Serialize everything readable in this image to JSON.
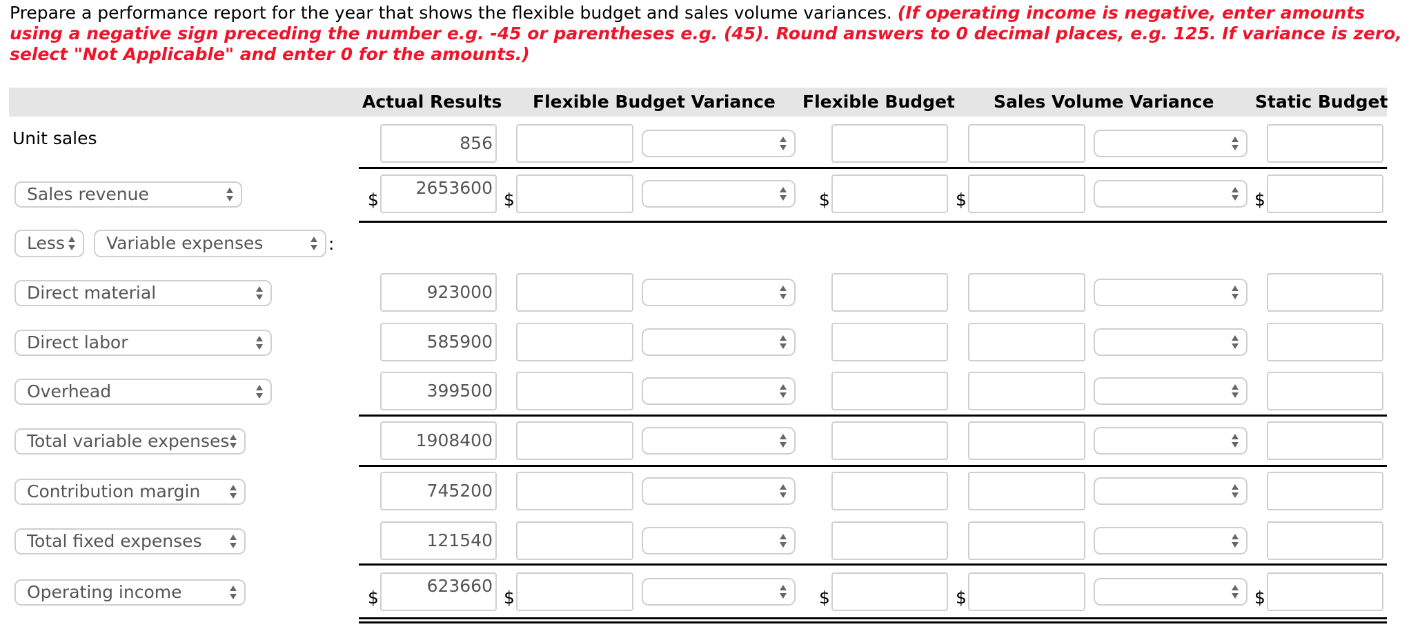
{
  "instructions": {
    "plain": "Prepare a performance report for the year that shows the flexible budget and sales volume variances. ",
    "emphasis": "(If operating income is negative, enter amounts using a negative sign preceding the number e.g. -45 or parentheses e.g. (45). Round answers to 0 decimal places, e.g. 125. If variance is zero, select \"Not Applicable\" and enter 0 for the amounts.)"
  },
  "columns": [
    "Actual Results",
    "Flexible Budget Variance",
    "Flexible Budget",
    "Sales Volume Variance",
    "Static Budget"
  ],
  "rows": [
    {
      "label": "Unit sales",
      "label_is_select": false,
      "actual": "856",
      "dollar": false
    },
    {
      "label": "Sales revenue",
      "label_is_select": true,
      "actual": "2653600",
      "dollar": true
    },
    {
      "label_prefix": "Less",
      "label": "Variable expenses",
      "label_is_select": true,
      "heading": true,
      "suffix": ":"
    },
    {
      "label": "Direct material",
      "label_is_select": true,
      "actual": "923000",
      "dollar": false
    },
    {
      "label": "Direct labor",
      "label_is_select": true,
      "actual": "585900",
      "dollar": false
    },
    {
      "label": "Overhead",
      "label_is_select": true,
      "actual": "399500",
      "dollar": false
    },
    {
      "label": "Total variable expenses",
      "label_is_select": true,
      "actual": "1908400",
      "dollar": false
    },
    {
      "label": "Contribution margin",
      "label_is_select": true,
      "actual": "745200",
      "dollar": false
    },
    {
      "label": "Total fixed expenses",
      "label_is_select": true,
      "actual": "121540",
      "dollar": false
    },
    {
      "label": "Operating income",
      "label_is_select": true,
      "actual": "623660",
      "dollar": true
    }
  ],
  "currency_symbol": "$",
  "colors": {
    "instruction_red": "#f0142a",
    "header_bg": "#e5e5e5",
    "field_border": "#cfcfcf"
  }
}
